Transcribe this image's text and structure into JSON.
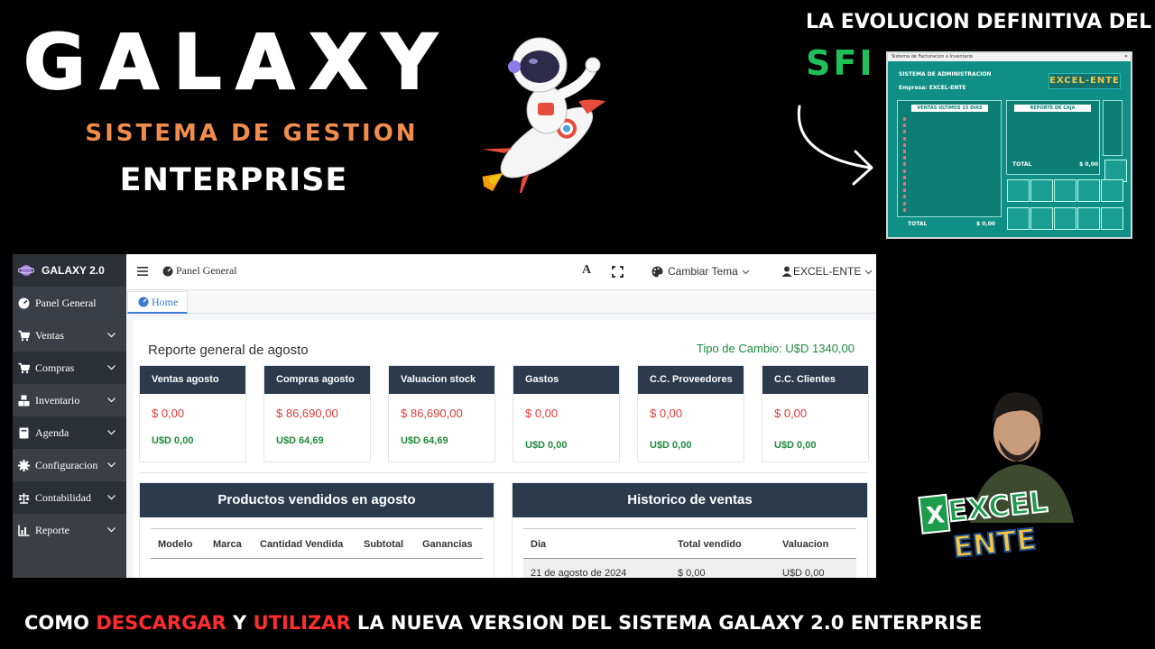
{
  "hero": {
    "brand": "GALAXY",
    "subtitle": "SISTEMA DE GESTION",
    "edition": "ENTERPRISE",
    "tagline": "LA EVOLUCION DEFINITIVA DEL",
    "tagline_accent": "SFI"
  },
  "sfi_window": {
    "title": "Sistema de Facturacion e Inventario",
    "system_label": "SISTEMA DE ADMINISTRACION",
    "company": "Empresa:  EXCEL-ENTE",
    "logo_text": "EXCEL-ENTE",
    "sales_title": "VENTAS ULTIMOS 15 DIAS",
    "cash_title": "REPORTE DE CAJA",
    "total_label": "TOTAL",
    "total_value": "$ 0,00",
    "cash_total_value": "$ 0,00"
  },
  "app": {
    "brand": "GALAXY 2.0",
    "sidebar": [
      {
        "label": "Panel General",
        "icon": "dashboard-icon",
        "expandable": false
      },
      {
        "label": "Ventas",
        "icon": "cart-icon",
        "expandable": true
      },
      {
        "label": "Compras",
        "icon": "cart-icon",
        "expandable": true
      },
      {
        "label": "Inventario",
        "icon": "boxes-icon",
        "expandable": true
      },
      {
        "label": "Agenda",
        "icon": "book-icon",
        "expandable": true
      },
      {
        "label": "Configuracion",
        "icon": "gear-icon",
        "expandable": true
      },
      {
        "label": "Contabilidad",
        "icon": "scale-icon",
        "expandable": true
      },
      {
        "label": "Reporte",
        "icon": "chart-icon",
        "expandable": true
      }
    ],
    "topbar": {
      "page": "Panel General",
      "font_button": "A",
      "theme_label": "Cambiar Tema",
      "user_label": "EXCEL-ENTE"
    },
    "tab_home": "Home",
    "report_title": "Reporte general de agosto",
    "exchange": "Tipo de Cambio: U$D 1340,00",
    "kpis": [
      {
        "title": "Ventas agosto",
        "value": "$ 0,00",
        "usd": "U$D 0,00"
      },
      {
        "title": "Compras agosto",
        "value": "$ 86,690,00",
        "usd": "U$D 64,69"
      },
      {
        "title": "Valuacion stock",
        "value": "$ 86,690,00",
        "usd": "U$D 64,69"
      },
      {
        "title": "Gastos",
        "value": "$ 0,00",
        "usd": "U$D 0,00"
      },
      {
        "title": "C.C. Proveedores",
        "value": "$ 0,00",
        "usd": "U$D 0,00"
      },
      {
        "title": "C.C. Clientes",
        "value": "$ 0,00",
        "usd": "U$D 0,00"
      }
    ],
    "products_table": {
      "title": "Productos vendidos en agosto",
      "columns": [
        "Modelo",
        "Marca",
        "Cantidad Vendida",
        "Subtotal",
        "Ganancias"
      ]
    },
    "history_table": {
      "title": "Historico de ventas",
      "columns": [
        "Dia",
        "Total vendido",
        "Valuacion"
      ],
      "rows": [
        {
          "dia": "21 de agosto de 2024",
          "total": "$ 0,00",
          "valuacion": "U$D 0,00"
        }
      ]
    }
  },
  "footer": {
    "p1": "COMO ",
    "p2": "DESCARGAR",
    "p3": " Y ",
    "p4": "UTILIZAR",
    "p5": " LA NUEVA VERSION DEL SISTEMA GALAXY 2.0 ENTERPRISE"
  },
  "colors": {
    "accent_orange": "#f08d4c",
    "accent_green": "#1fbf5a",
    "footer_red": "#ff2d2d",
    "card_header": "#2b3a4c",
    "value_red": "#e03b3b",
    "usd_green": "#1f8a3b",
    "sidebar_bg": "#2b2f36"
  }
}
